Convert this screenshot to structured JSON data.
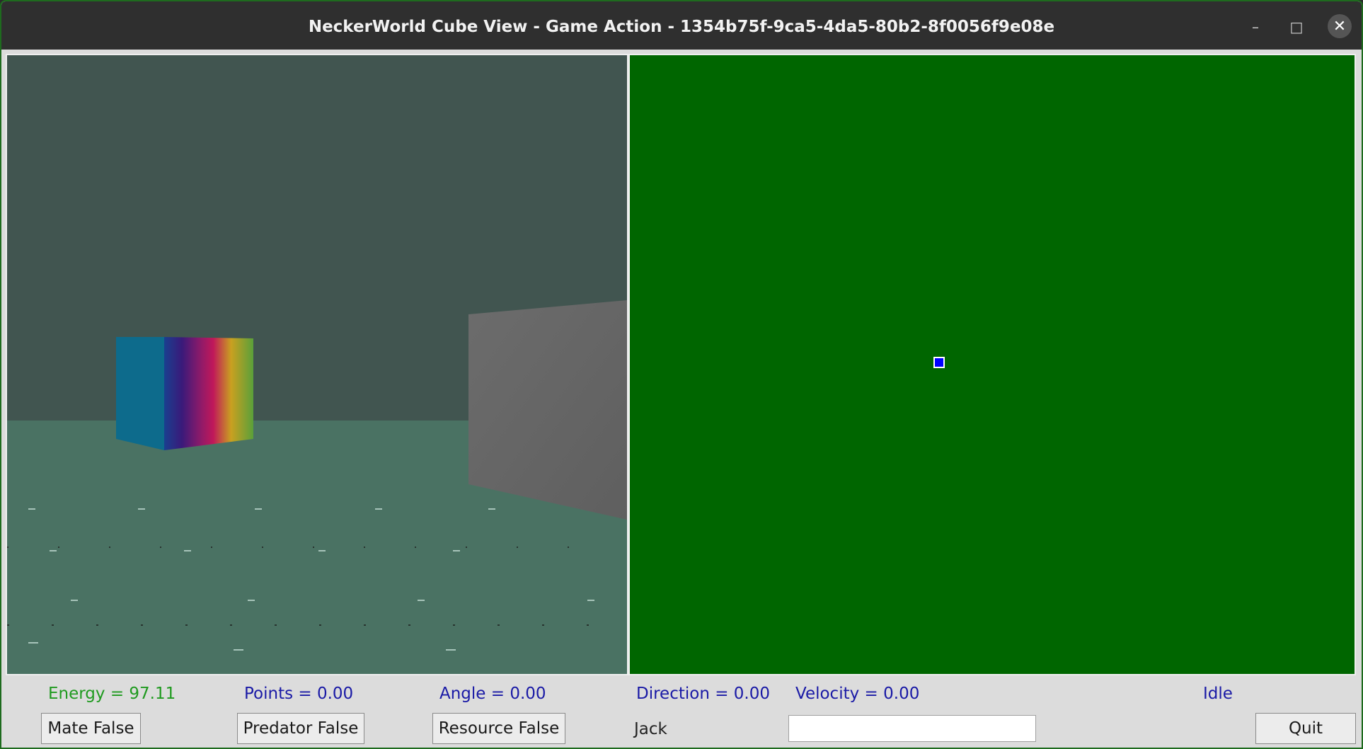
{
  "window": {
    "title": "NeckerWorld Cube View - Game Action - 1354b75f-9ca5-4da5-80b2-8f0056f9e08e",
    "controls": {
      "minimize": "–",
      "maximize": "□",
      "close": "✕"
    }
  },
  "scene": {
    "sky_color": "#415550",
    "floor_color": "#4a7263",
    "wall_color": "#6a6a6a",
    "cube_face_color": "#0d6b8c"
  },
  "map": {
    "background": "#006600",
    "agent_color": "#0000ff"
  },
  "status": {
    "energy": "Energy = 97.11",
    "points": "Points = 0.00",
    "angle": "Angle = 0.00",
    "direction": "Direction = 0.00",
    "velocity": "Velocity = 0.00",
    "state": "Idle",
    "energy_color": "#1f9a1f"
  },
  "buttons": {
    "mate": "Mate False",
    "predator": "Predator False",
    "resource": "Resource False",
    "quit": "Quit"
  },
  "name": {
    "label": "Jack",
    "value": ""
  }
}
